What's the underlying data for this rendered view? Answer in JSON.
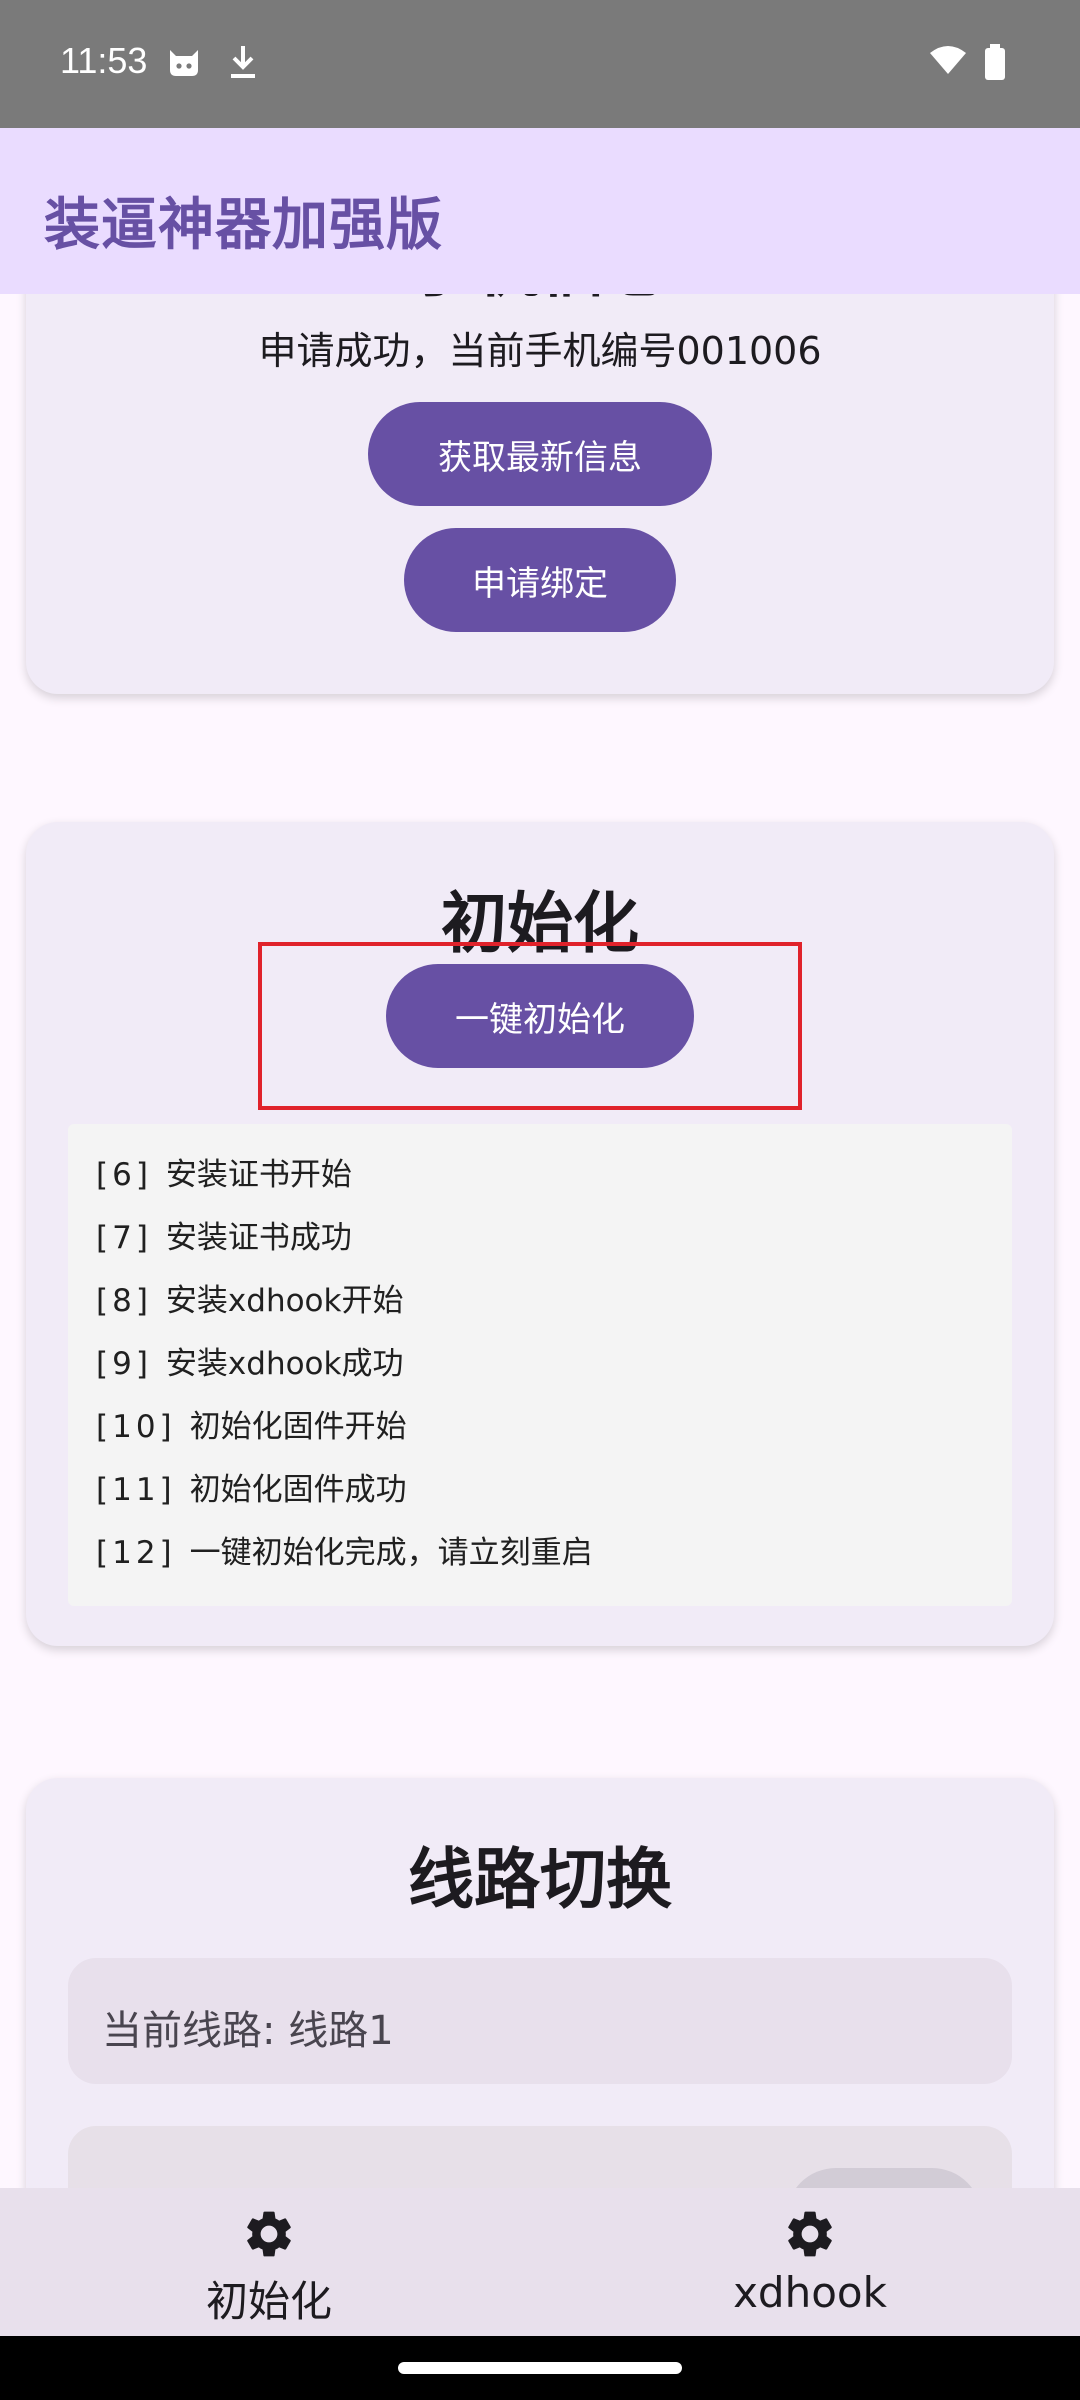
{
  "status_bar": {
    "time": "11:53",
    "icons": [
      "cat-icon",
      "download-icon",
      "wifi-icon",
      "battery-icon"
    ]
  },
  "app_bar": {
    "title": "装逼神器加强版"
  },
  "phone_card": {
    "title": "手机信息",
    "message": "申请成功，当前手机编号001006",
    "refresh_button": "获取最新信息",
    "bind_button": "申请绑定"
  },
  "init_card": {
    "title": "初始化",
    "init_button": "一键初始化",
    "logs": [
      {
        "idx": "[6]",
        "text": "安装证书开始"
      },
      {
        "idx": "[7]",
        "text": "安装证书成功"
      },
      {
        "idx": "[8]",
        "text": "安装xdhook开始"
      },
      {
        "idx": "[9]",
        "text": "安装xdhook成功"
      },
      {
        "idx": "[10]",
        "text": "初始化固件开始"
      },
      {
        "idx": "[11]",
        "text": "初始化固件成功"
      },
      {
        "idx": "[12]",
        "text": "一键初始化完成，请立刻重启"
      }
    ]
  },
  "route_card": {
    "title": "线路切换",
    "current_route": "当前线路: 线路1"
  },
  "bottom_nav": {
    "items": [
      {
        "label": "初始化",
        "icon": "gear-icon"
      },
      {
        "label": "xdhook",
        "icon": "gear-icon"
      }
    ]
  },
  "colors": {
    "primary": "#6750a4",
    "app_bar_bg": "#eadcff",
    "card_bg": "#f1ebf7",
    "highlight": "#e0222b"
  }
}
